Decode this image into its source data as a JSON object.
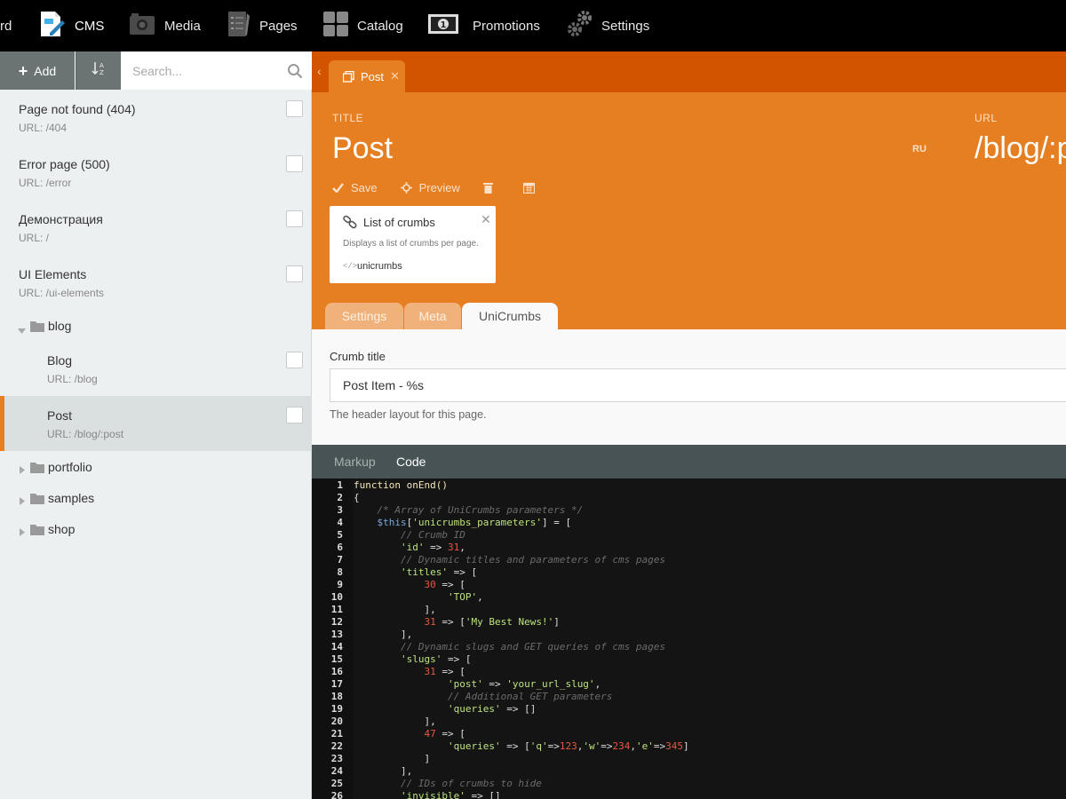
{
  "nav": [
    {
      "label": "rd",
      "icon": "dashboard-icon"
    },
    {
      "label": "CMS",
      "icon": "cms-icon",
      "active": true
    },
    {
      "label": "Media",
      "icon": "media-icon"
    },
    {
      "label": "Pages",
      "icon": "pages-icon"
    },
    {
      "label": "Catalog",
      "icon": "catalog-icon"
    },
    {
      "label": "Promotions",
      "icon": "promotions-icon"
    },
    {
      "label": "Settings",
      "icon": "settings-icon"
    }
  ],
  "sidebar": {
    "add_label": "Add",
    "search_placeholder": "Search...",
    "pages": [
      {
        "title": "Page not found (404)",
        "url": "URL: /404"
      },
      {
        "title": "Error page (500)",
        "url": "URL: /error"
      },
      {
        "title": "Демонстрация",
        "url": "URL: /"
      },
      {
        "title": "UI Elements",
        "url": "URL: /ui-elements"
      }
    ],
    "blog_folder": "blog",
    "blog_pages": [
      {
        "title": "Blog",
        "url": "URL: /blog"
      },
      {
        "title": "Post",
        "url": "URL: /blog/:post",
        "active": true
      }
    ],
    "folders": [
      "portfolio",
      "samples",
      "shop"
    ]
  },
  "editor": {
    "tab_label": "Post",
    "title_label": "TITLE",
    "title_value": "Post",
    "url_label": "URL",
    "url_value": "/blog/:post",
    "locale": "RU",
    "save_label": "Save",
    "preview_label": "Preview",
    "component": {
      "name": "List of crumbs",
      "description": "Displays a list of crumbs per page.",
      "alias_icon": "</>",
      "alias": "unicrumbs"
    },
    "form_tabs": [
      "Settings",
      "Meta",
      "UniCrumbs"
    ],
    "crumb_title_label": "Crumb title",
    "crumb_title_value": "Post Item - %s",
    "crumb_title_help": "The header layout for this page.",
    "code_tabs": [
      "Markup",
      "Code"
    ]
  },
  "code_lines": [
    [
      [
        "k",
        "function onEnd()"
      ]
    ],
    [
      [
        "p",
        "{"
      ]
    ],
    [
      [
        "p",
        "    "
      ],
      [
        "c",
        "/* Array of UniCrumbs parameters */"
      ]
    ],
    [
      [
        "p",
        "    "
      ],
      [
        "v",
        "$this"
      ],
      [
        "p",
        "["
      ],
      [
        "s",
        "'unicrumbs_parameters'"
      ],
      [
        "p",
        "] = ["
      ]
    ],
    [
      [
        "p",
        "        "
      ],
      [
        "c",
        "// Crumb ID"
      ]
    ],
    [
      [
        "p",
        "        "
      ],
      [
        "s",
        "'id'"
      ],
      [
        "p",
        " => "
      ],
      [
        "n",
        "31"
      ],
      [
        "p",
        ","
      ]
    ],
    [
      [
        "p",
        "        "
      ],
      [
        "c",
        "// Dynamic titles and parameters of cms pages"
      ]
    ],
    [
      [
        "p",
        "        "
      ],
      [
        "s",
        "'titles'"
      ],
      [
        "p",
        " => ["
      ]
    ],
    [
      [
        "p",
        "            "
      ],
      [
        "n",
        "30"
      ],
      [
        "p",
        " => ["
      ]
    ],
    [
      [
        "p",
        "                "
      ],
      [
        "s",
        "'TOP'"
      ],
      [
        "p",
        ","
      ]
    ],
    [
      [
        "p",
        "            ],"
      ]
    ],
    [
      [
        "p",
        "            "
      ],
      [
        "n",
        "31"
      ],
      [
        "p",
        " => ["
      ],
      [
        "s",
        "'My Best News!'"
      ],
      [
        "p",
        "]"
      ]
    ],
    [
      [
        "p",
        "        ],"
      ]
    ],
    [
      [
        "p",
        "        "
      ],
      [
        "c",
        "// Dynamic slugs and GET queries of cms pages"
      ]
    ],
    [
      [
        "p",
        "        "
      ],
      [
        "s",
        "'slugs'"
      ],
      [
        "p",
        " => ["
      ]
    ],
    [
      [
        "p",
        "            "
      ],
      [
        "n",
        "31"
      ],
      [
        "p",
        " => ["
      ]
    ],
    [
      [
        "p",
        "                "
      ],
      [
        "s",
        "'post'"
      ],
      [
        "p",
        " => "
      ],
      [
        "s",
        "'your_url_slug'"
      ],
      [
        "p",
        ","
      ]
    ],
    [
      [
        "p",
        "                "
      ],
      [
        "c",
        "// Additional GET parameters"
      ]
    ],
    [
      [
        "p",
        "                "
      ],
      [
        "s",
        "'queries'"
      ],
      [
        "p",
        " => []"
      ]
    ],
    [
      [
        "p",
        "            ],"
      ]
    ],
    [
      [
        "p",
        "            "
      ],
      [
        "n",
        "47"
      ],
      [
        "p",
        " => ["
      ]
    ],
    [
      [
        "p",
        "                "
      ],
      [
        "s",
        "'queries'"
      ],
      [
        "p",
        " => ["
      ],
      [
        "s",
        "'q'"
      ],
      [
        "p",
        "=>"
      ],
      [
        "n",
        "123"
      ],
      [
        "p",
        ","
      ],
      [
        "s",
        "'w'"
      ],
      [
        "p",
        "=>"
      ],
      [
        "n",
        "234"
      ],
      [
        "p",
        ","
      ],
      [
        "s",
        "'e'"
      ],
      [
        "p",
        "=>"
      ],
      [
        "n",
        "345"
      ],
      [
        "p",
        "]"
      ]
    ],
    [
      [
        "p",
        "            ]"
      ]
    ],
    [
      [
        "p",
        "        ],"
      ]
    ],
    [
      [
        "p",
        "        "
      ],
      [
        "c",
        "// IDs of crumbs to hide"
      ]
    ],
    [
      [
        "p",
        "        "
      ],
      [
        "s",
        "'invisible'"
      ],
      [
        "p",
        " => []"
      ]
    ]
  ]
}
